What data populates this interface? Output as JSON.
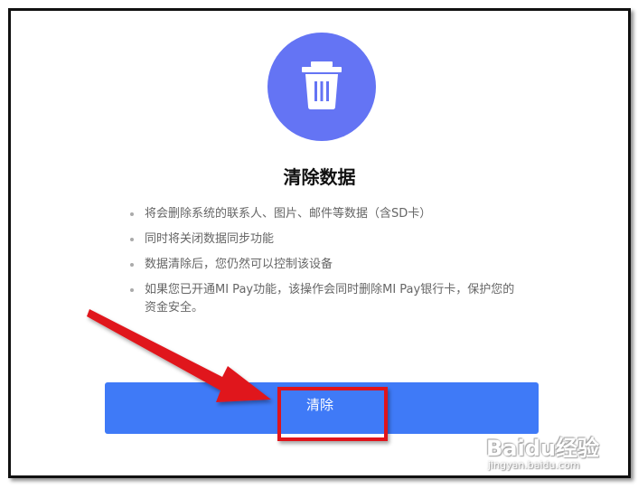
{
  "dialog": {
    "icon": "trash-icon",
    "title": "清除数据",
    "bullets": [
      "将会删除系统的联系人、图片、邮件等数据（含SD卡）",
      "同时将关闭数据同步功能",
      "数据清除后，您仍然可以控制该设备",
      "如果您已开通MI Pay功能，该操作会同时删除MI Pay银行卡，保护您的资金安全。"
    ],
    "clear_button_label": "清除"
  },
  "colors": {
    "icon_circle": "#6474f4",
    "button": "#3f7af7",
    "annotation": "#e0141b"
  },
  "watermark": {
    "brand": "Baidu经验",
    "url": "jingyan.baidu.com"
  }
}
